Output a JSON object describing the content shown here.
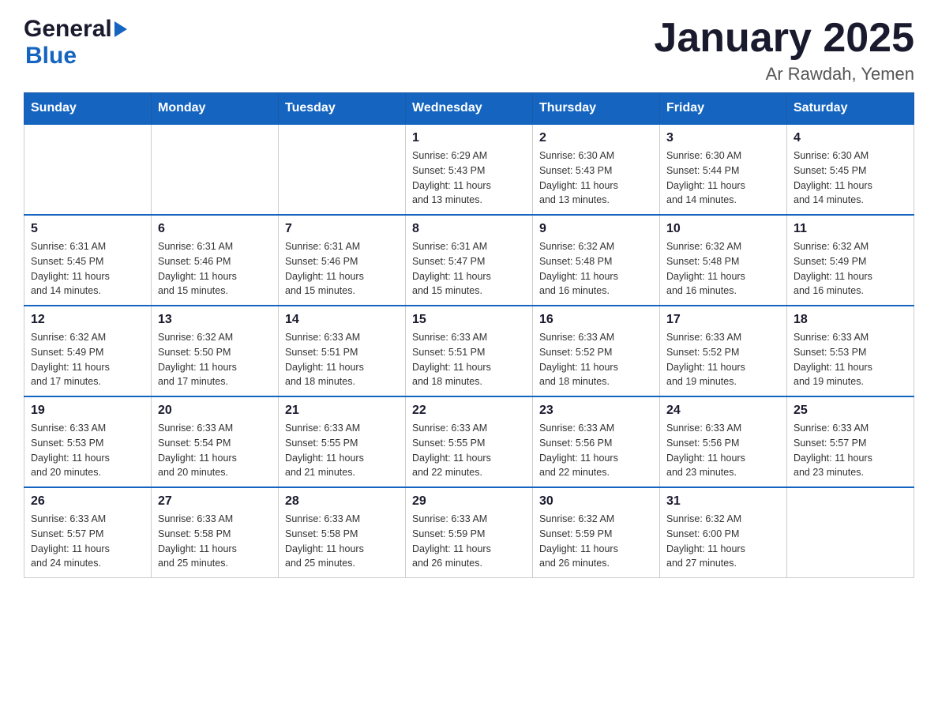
{
  "header": {
    "logo_general": "General",
    "logo_blue": "Blue",
    "title": "January 2025",
    "subtitle": "Ar Rawdah, Yemen"
  },
  "days_of_week": [
    "Sunday",
    "Monday",
    "Tuesday",
    "Wednesday",
    "Thursday",
    "Friday",
    "Saturday"
  ],
  "weeks": [
    [
      {
        "day": "",
        "info": ""
      },
      {
        "day": "",
        "info": ""
      },
      {
        "day": "",
        "info": ""
      },
      {
        "day": "1",
        "info": "Sunrise: 6:29 AM\nSunset: 5:43 PM\nDaylight: 11 hours\nand 13 minutes."
      },
      {
        "day": "2",
        "info": "Sunrise: 6:30 AM\nSunset: 5:43 PM\nDaylight: 11 hours\nand 13 minutes."
      },
      {
        "day": "3",
        "info": "Sunrise: 6:30 AM\nSunset: 5:44 PM\nDaylight: 11 hours\nand 14 minutes."
      },
      {
        "day": "4",
        "info": "Sunrise: 6:30 AM\nSunset: 5:45 PM\nDaylight: 11 hours\nand 14 minutes."
      }
    ],
    [
      {
        "day": "5",
        "info": "Sunrise: 6:31 AM\nSunset: 5:45 PM\nDaylight: 11 hours\nand 14 minutes."
      },
      {
        "day": "6",
        "info": "Sunrise: 6:31 AM\nSunset: 5:46 PM\nDaylight: 11 hours\nand 15 minutes."
      },
      {
        "day": "7",
        "info": "Sunrise: 6:31 AM\nSunset: 5:46 PM\nDaylight: 11 hours\nand 15 minutes."
      },
      {
        "day": "8",
        "info": "Sunrise: 6:31 AM\nSunset: 5:47 PM\nDaylight: 11 hours\nand 15 minutes."
      },
      {
        "day": "9",
        "info": "Sunrise: 6:32 AM\nSunset: 5:48 PM\nDaylight: 11 hours\nand 16 minutes."
      },
      {
        "day": "10",
        "info": "Sunrise: 6:32 AM\nSunset: 5:48 PM\nDaylight: 11 hours\nand 16 minutes."
      },
      {
        "day": "11",
        "info": "Sunrise: 6:32 AM\nSunset: 5:49 PM\nDaylight: 11 hours\nand 16 minutes."
      }
    ],
    [
      {
        "day": "12",
        "info": "Sunrise: 6:32 AM\nSunset: 5:49 PM\nDaylight: 11 hours\nand 17 minutes."
      },
      {
        "day": "13",
        "info": "Sunrise: 6:32 AM\nSunset: 5:50 PM\nDaylight: 11 hours\nand 17 minutes."
      },
      {
        "day": "14",
        "info": "Sunrise: 6:33 AM\nSunset: 5:51 PM\nDaylight: 11 hours\nand 18 minutes."
      },
      {
        "day": "15",
        "info": "Sunrise: 6:33 AM\nSunset: 5:51 PM\nDaylight: 11 hours\nand 18 minutes."
      },
      {
        "day": "16",
        "info": "Sunrise: 6:33 AM\nSunset: 5:52 PM\nDaylight: 11 hours\nand 18 minutes."
      },
      {
        "day": "17",
        "info": "Sunrise: 6:33 AM\nSunset: 5:52 PM\nDaylight: 11 hours\nand 19 minutes."
      },
      {
        "day": "18",
        "info": "Sunrise: 6:33 AM\nSunset: 5:53 PM\nDaylight: 11 hours\nand 19 minutes."
      }
    ],
    [
      {
        "day": "19",
        "info": "Sunrise: 6:33 AM\nSunset: 5:53 PM\nDaylight: 11 hours\nand 20 minutes."
      },
      {
        "day": "20",
        "info": "Sunrise: 6:33 AM\nSunset: 5:54 PM\nDaylight: 11 hours\nand 20 minutes."
      },
      {
        "day": "21",
        "info": "Sunrise: 6:33 AM\nSunset: 5:55 PM\nDaylight: 11 hours\nand 21 minutes."
      },
      {
        "day": "22",
        "info": "Sunrise: 6:33 AM\nSunset: 5:55 PM\nDaylight: 11 hours\nand 22 minutes."
      },
      {
        "day": "23",
        "info": "Sunrise: 6:33 AM\nSunset: 5:56 PM\nDaylight: 11 hours\nand 22 minutes."
      },
      {
        "day": "24",
        "info": "Sunrise: 6:33 AM\nSunset: 5:56 PM\nDaylight: 11 hours\nand 23 minutes."
      },
      {
        "day": "25",
        "info": "Sunrise: 6:33 AM\nSunset: 5:57 PM\nDaylight: 11 hours\nand 23 minutes."
      }
    ],
    [
      {
        "day": "26",
        "info": "Sunrise: 6:33 AM\nSunset: 5:57 PM\nDaylight: 11 hours\nand 24 minutes."
      },
      {
        "day": "27",
        "info": "Sunrise: 6:33 AM\nSunset: 5:58 PM\nDaylight: 11 hours\nand 25 minutes."
      },
      {
        "day": "28",
        "info": "Sunrise: 6:33 AM\nSunset: 5:58 PM\nDaylight: 11 hours\nand 25 minutes."
      },
      {
        "day": "29",
        "info": "Sunrise: 6:33 AM\nSunset: 5:59 PM\nDaylight: 11 hours\nand 26 minutes."
      },
      {
        "day": "30",
        "info": "Sunrise: 6:32 AM\nSunset: 5:59 PM\nDaylight: 11 hours\nand 26 minutes."
      },
      {
        "day": "31",
        "info": "Sunrise: 6:32 AM\nSunset: 6:00 PM\nDaylight: 11 hours\nand 27 minutes."
      },
      {
        "day": "",
        "info": ""
      }
    ]
  ]
}
